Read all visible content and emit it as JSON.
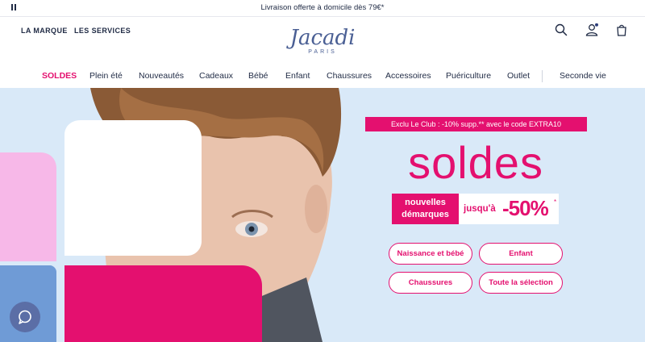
{
  "announcement": {
    "text": "Livraison offerte à domicile dès 79€*"
  },
  "header": {
    "left_links": [
      "LA MARQUE",
      "LES SERVICES"
    ],
    "logo": {
      "brand": "Jacadi",
      "sub": "PARIS"
    },
    "icons": [
      "search-icon",
      "account-icon",
      "cart-icon"
    ],
    "notification_dot_color": "#2d3e7a"
  },
  "nav": {
    "items": [
      "SOLDES",
      "Plein été",
      "Nouveautés",
      "Cadeaux",
      "Bébé",
      "Enfant",
      "Chaussures",
      "Accessoires",
      "Puériculture",
      "Outlet",
      "Seconde vie"
    ]
  },
  "hero": {
    "promo_badge": "Exclu Le Club : -10% supp.** avec le code EXTRA10",
    "title": "soldes",
    "nouvelles_line1": "nouvelles",
    "nouvelles_line2": "démarques",
    "jusqua": "jusqu'à",
    "percent": "-50%",
    "percent_mark": "*",
    "buttons": [
      "Naissance et bébé",
      "Enfant",
      "Chaussures",
      "Toute la sélection"
    ]
  },
  "colors": {
    "accent": "#e4106f",
    "navy": "#1f2a44",
    "hero_bg": "#d9e9f8",
    "pink_light": "#f7b8e8",
    "blue_block": "#6f9bd6"
  }
}
